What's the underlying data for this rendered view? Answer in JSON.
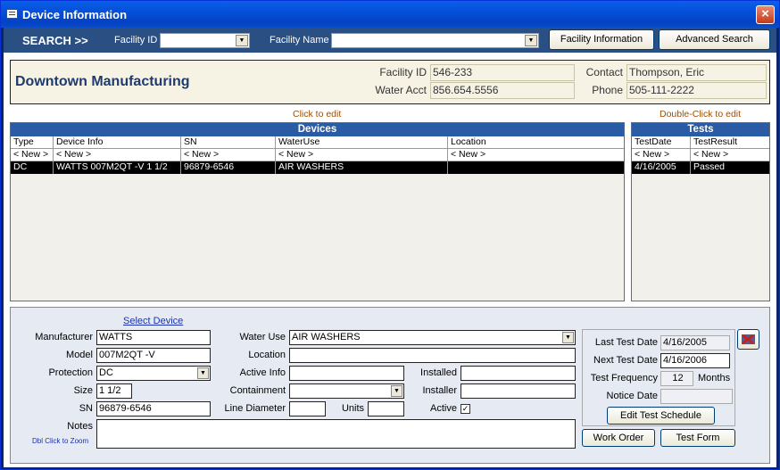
{
  "window": {
    "title": "Device Information",
    "close": "×"
  },
  "search": {
    "label": "SEARCH >>",
    "facility_id_label": "Facility ID",
    "facility_id_value": "",
    "facility_name_label": "Facility Name",
    "facility_name_value": "",
    "facility_info_button": "Facility Information",
    "advanced_search_button": "Advanced Search"
  },
  "facility": {
    "name": "Downtown Manufacturing",
    "facility_id_label": "Facility ID",
    "facility_id": "546-233",
    "water_acct_label": "Water Acct",
    "water_acct": "856.654.5556",
    "contact_label": "Contact",
    "contact": "Thompson, Eric",
    "phone_label": "Phone",
    "phone": "505-111-2222"
  },
  "devices": {
    "hint": "Click to edit",
    "title": "Devices",
    "columns": [
      "Type",
      "Device Info",
      "SN",
      "WaterUse",
      "Location"
    ],
    "new_row": [
      "< New >",
      "< New >",
      "< New >",
      "< New >",
      "< New >"
    ],
    "rows": [
      [
        "DC",
        "WATTS 007M2QT -V 1 1/2",
        "96879-6546",
        "AIR WASHERS",
        ""
      ]
    ]
  },
  "tests": {
    "hint": "Double-Click to edit",
    "title": "Tests",
    "columns": [
      "TestDate",
      "TestResult"
    ],
    "new_row": [
      "< New >",
      "< New >"
    ],
    "rows": [
      [
        "4/16/2005",
        "Passed"
      ]
    ]
  },
  "detail": {
    "select_device": "Select Device",
    "manufacturer_label": "Manufacturer",
    "manufacturer": "WATTS",
    "model_label": "Model",
    "model": "007M2QT -V",
    "protection_label": "Protection",
    "protection": "DC",
    "size_label": "Size",
    "size": "1 1/2",
    "sn_label": "SN",
    "sn": "96879-6546",
    "notes_label": "Notes",
    "notes": "",
    "zoom_hint": "Dbl Click to Zoom",
    "water_use_label": "Water Use",
    "water_use": "AIR WASHERS",
    "location_label": "Location",
    "location": "",
    "active_info_label": "Active Info",
    "active_info": "",
    "containment_label": "Containment",
    "containment": "",
    "line_diameter_label": "Line Diameter",
    "line_diameter": "",
    "units_label": "Units",
    "units": "",
    "installed_label": "Installed",
    "installed": "",
    "installer_label": "Installer",
    "installer": "",
    "active_label": "Active",
    "active": "✓",
    "last_test_label": "Last Test Date",
    "last_test": "4/16/2005",
    "next_test_label": "Next Test Date",
    "next_test": "4/16/2006",
    "frequency_label": "Test Frequency",
    "frequency": "12",
    "months_label": "Months",
    "notice_label": "Notice Date",
    "notice": "",
    "edit_schedule_button": "Edit Test Schedule",
    "work_order_button": "Work Order",
    "test_form_button": "Test Form"
  }
}
